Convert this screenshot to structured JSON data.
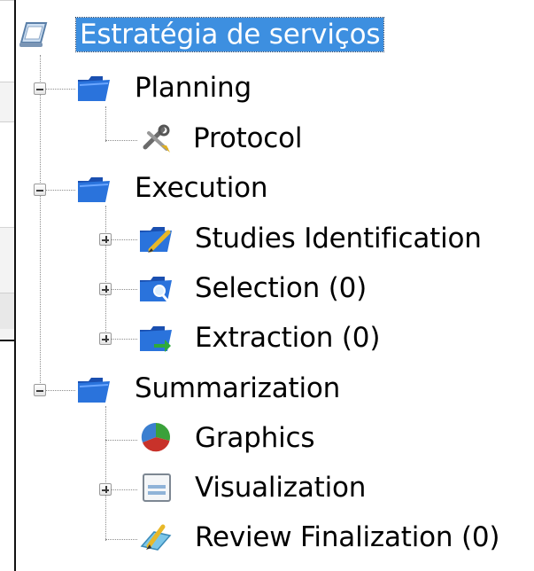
{
  "tree": {
    "root": {
      "label": "Estratégia de serviços",
      "icon": "review-root-icon",
      "selected": true
    },
    "nodes": [
      {
        "id": "planning",
        "label": "Planning",
        "icon": "folder-icon",
        "expander": "collapse"
      },
      {
        "id": "protocol",
        "label": "Protocol",
        "icon": "protocol-tools-icon",
        "expander": null
      },
      {
        "id": "execution",
        "label": "Execution",
        "icon": "folder-icon",
        "expander": "collapse"
      },
      {
        "id": "studies",
        "label": "Studies Identification",
        "icon": "folder-edit-icon",
        "expander": "expand"
      },
      {
        "id": "selection",
        "label": "Selection (0)",
        "icon": "folder-search-icon",
        "expander": "expand"
      },
      {
        "id": "extraction",
        "label": "Extraction (0)",
        "icon": "folder-arrow-icon",
        "expander": "expand"
      },
      {
        "id": "summarization",
        "label": "Summarization",
        "icon": "folder-icon",
        "expander": "collapse"
      },
      {
        "id": "graphics",
        "label": "Graphics",
        "icon": "pie-chart-icon",
        "expander": null
      },
      {
        "id": "visualization",
        "label": "Visualization",
        "icon": "window-icon",
        "expander": "expand"
      },
      {
        "id": "finalization",
        "label": "Review Finalization (0)",
        "icon": "finalize-pencil-icon",
        "expander": null
      }
    ]
  },
  "colors": {
    "selection_bg": "#3d8fe0",
    "folder_blue": "#1e5fc8",
    "pie_green": "#3aa13a",
    "pie_red": "#c8322a",
    "pie_blue": "#3b7fd0"
  }
}
